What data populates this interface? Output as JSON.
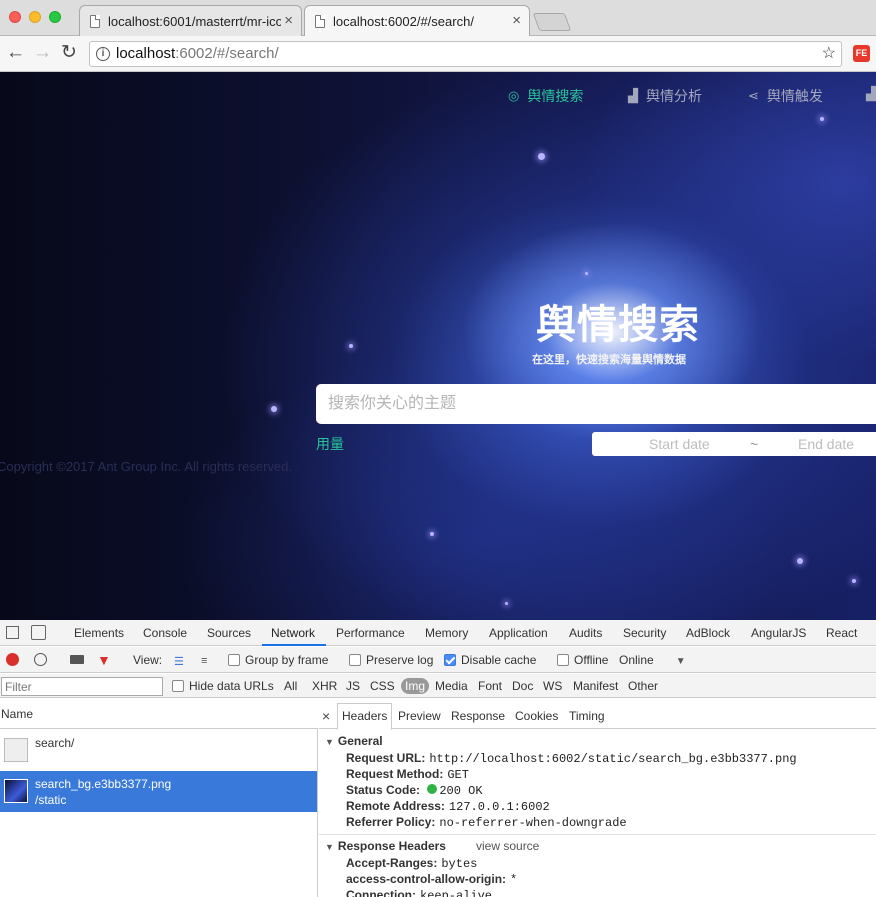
{
  "browser": {
    "tabs": [
      {
        "title": "localhost:6001/masterrt/mr-ico"
      },
      {
        "title": "localhost:6002/#/search/"
      }
    ],
    "close_glyph": "×",
    "url_host": "localhost",
    "url_rest": ":6002/#/search/",
    "ext_badge": "FE"
  },
  "nav": {
    "items": [
      {
        "label": "舆情搜索",
        "icon": "compass-icon"
      },
      {
        "label": "舆情分析",
        "icon": "chart-icon"
      },
      {
        "label": "舆情触发",
        "icon": "share-icon"
      }
    ],
    "active_color": "#27c69a"
  },
  "hero": {
    "title": "舆情搜索",
    "subtitle": "在这里，快速搜索海量舆情数据"
  },
  "search": {
    "placeholder": "搜索你关心的主题",
    "usage_label": "用量",
    "start_placeholder": "Start date",
    "separator": "~",
    "end_placeholder": "End date"
  },
  "footer": {
    "copyright": "Copyright ©2017 Ant Group Inc. All rights reserved."
  },
  "devtools": {
    "tabs": [
      "Elements",
      "Console",
      "Sources",
      "Network",
      "Performance",
      "Memory",
      "Application",
      "Audits",
      "Security",
      "AdBlock",
      "AngularJS",
      "React"
    ],
    "active_tab": "Network",
    "toolbar": {
      "view_label": "View:",
      "group_by_frame": "Group by frame",
      "preserve_log": "Preserve log",
      "disable_cache": "Disable cache",
      "offline": "Offline",
      "throttle": "Online"
    },
    "filter": {
      "placeholder": "Filter",
      "hide_data_urls": "Hide data URLs",
      "types": [
        "All",
        "XHR",
        "JS",
        "CSS",
        "Img",
        "Media",
        "Font",
        "Doc",
        "WS",
        "Manifest",
        "Other"
      ],
      "selected_type": "Img"
    },
    "list": {
      "header": "Name",
      "rows": [
        {
          "name": "search/",
          "path": ""
        },
        {
          "name": "search_bg.e3bb3377.png",
          "path": "/static"
        }
      ]
    },
    "detail": {
      "tabs": [
        "Headers",
        "Preview",
        "Response",
        "Cookies",
        "Timing"
      ],
      "active_tab": "Headers",
      "general_title": "General",
      "general": [
        {
          "key": "Request URL:",
          "value": "http://localhost:6002/static/search_bg.e3bb3377.png"
        },
        {
          "key": "Request Method:",
          "value": "GET"
        },
        {
          "key": "Status Code:",
          "value": "200 OK"
        },
        {
          "key": "Remote Address:",
          "value": "127.0.0.1:6002"
        },
        {
          "key": "Referrer Policy:",
          "value": "no-referrer-when-downgrade"
        }
      ],
      "response_title": "Response Headers",
      "view_source": "view source",
      "response": [
        {
          "key": "Accept-Ranges:",
          "value": "bytes"
        },
        {
          "key": "access-control-allow-origin:",
          "value": "*"
        },
        {
          "key": "Connection:",
          "value": "keep-alive"
        }
      ]
    }
  }
}
